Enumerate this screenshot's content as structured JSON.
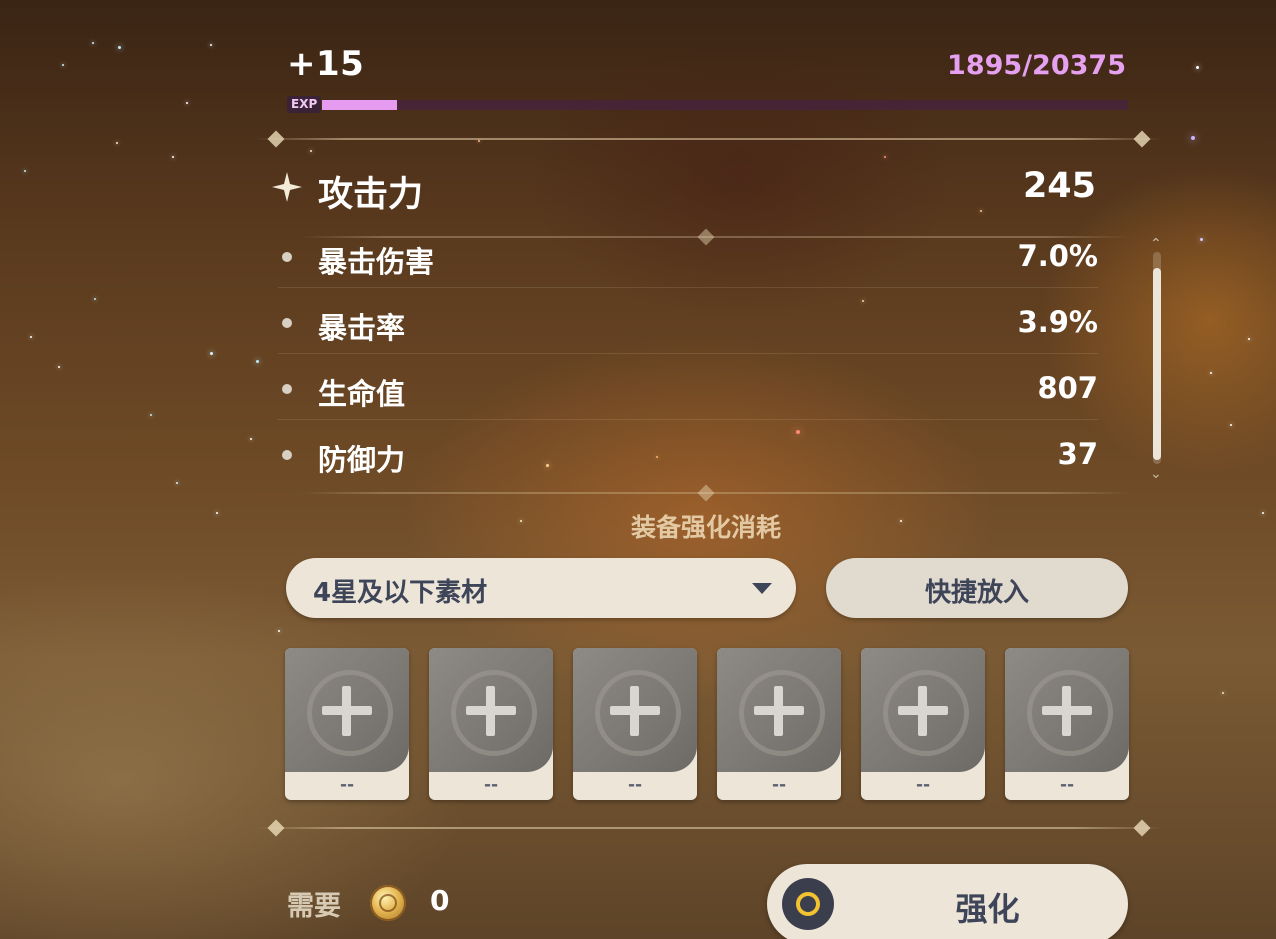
{
  "level": {
    "label": "+15"
  },
  "exp": {
    "badge": "EXP",
    "count": "1895/20375",
    "progress": 0.093
  },
  "main_stat": {
    "name": "攻击力",
    "value": "245"
  },
  "sub_stats": [
    {
      "name": "暴击伤害",
      "value": "7.0%"
    },
    {
      "name": "暴击率",
      "value": "3.9%"
    },
    {
      "name": "生命值",
      "value": "807"
    },
    {
      "name": "防御力",
      "value": "37"
    }
  ],
  "consumption": {
    "title": "装备强化消耗",
    "filter_select": "4星及以下素材",
    "quick_add_label": "快捷放入",
    "slots": [
      {
        "count": "--"
      },
      {
        "count": "--"
      },
      {
        "count": "--"
      },
      {
        "count": "--"
      },
      {
        "count": "--"
      },
      {
        "count": "--"
      }
    ]
  },
  "cost": {
    "label": "需要",
    "currency_icon": "mora-coin-icon",
    "amount": "0"
  },
  "actions": {
    "enhance_label": "强化"
  },
  "colors": {
    "exp_fill": "#e59cf0",
    "exp_text": "#e6a0f0",
    "button_bg": "#ece5d8",
    "button_text": "#3f4558",
    "section_title": "#e3c9a3"
  }
}
